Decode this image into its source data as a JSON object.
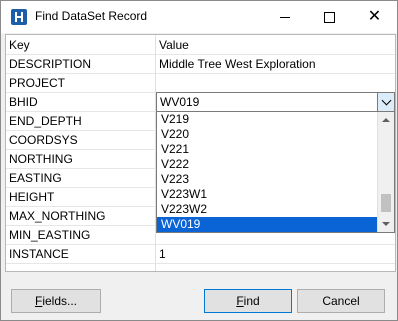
{
  "window": {
    "title": "Find DataSet Record"
  },
  "grid": {
    "header": {
      "key": "Key",
      "value": "Value"
    },
    "rows": [
      {
        "key": "DESCRIPTION",
        "value": "Middle Tree West Exploration"
      },
      {
        "key": "PROJECT",
        "value": ""
      },
      {
        "key": "BHID",
        "value": "WV019"
      },
      {
        "key": "END_DEPTH",
        "value": ""
      },
      {
        "key": "COORDSYS",
        "value": ""
      },
      {
        "key": "NORTHING",
        "value": ""
      },
      {
        "key": "EASTING",
        "value": ""
      },
      {
        "key": "HEIGHT",
        "value": ""
      },
      {
        "key": "MAX_NORTHING",
        "value": ""
      },
      {
        "key": "MIN_EASTING",
        "value": ""
      },
      {
        "key": "INSTANCE",
        "value": "1"
      }
    ]
  },
  "dropdown": {
    "items": [
      "V219",
      "V220",
      "V221",
      "V222",
      "V223",
      "V223W1",
      "V223W2",
      "WV019"
    ],
    "selected": "WV019"
  },
  "buttons": {
    "fields_first": "F",
    "fields_rest": "ields...",
    "find_first": "F",
    "find_rest": "ind",
    "cancel": "Cancel"
  },
  "icons": {
    "app": "dataset-app-icon",
    "minimize": "minimize-icon",
    "maximize": "maximize-icon",
    "close": "close-icon",
    "dropdown": "chevron-down-icon"
  },
  "colors": {
    "selection": "#0a64d6",
    "combo_button": "#dcecf9",
    "default_button_border": "#0078d7"
  }
}
